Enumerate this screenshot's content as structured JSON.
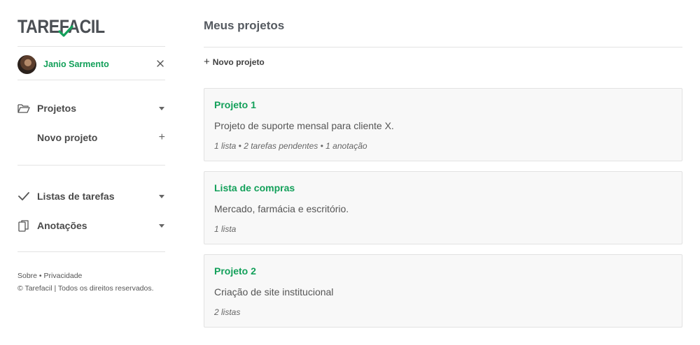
{
  "app": {
    "logo_text": "TAREFACIL"
  },
  "user": {
    "name": "Janio Sarmento"
  },
  "sidebar": {
    "items": [
      {
        "label": "Projetos",
        "icon": "folder-icon"
      },
      {
        "label": "Novo projeto",
        "icon": "plus-icon"
      },
      {
        "label": "Listas de tarefas",
        "icon": "check-icon"
      },
      {
        "label": "Anotações",
        "icon": "notes-icon"
      }
    ],
    "footer_links": "Sobre • Privacidade",
    "footer_copy": "© Tarefacil | Todos os direitos reservados."
  },
  "main": {
    "title": "Meus projetos",
    "new_project_label": "Novo projeto",
    "projects": [
      {
        "title": "Projeto 1",
        "description": "Projeto de suporte mensal para cliente X.",
        "meta": "1 lista • 2 tarefas pendentes • 1 anotação"
      },
      {
        "title": "Lista de compras",
        "description": "Mercado, farmácia e escritório.",
        "meta": "1 lista"
      },
      {
        "title": "Projeto 2",
        "description": "Criação de site institucional",
        "meta": "2 listas"
      }
    ]
  },
  "colors": {
    "accent": "#13a05a",
    "text": "#4a4a4a",
    "card_bg": "#f8f8f8",
    "divider": "#e3e3e3"
  }
}
